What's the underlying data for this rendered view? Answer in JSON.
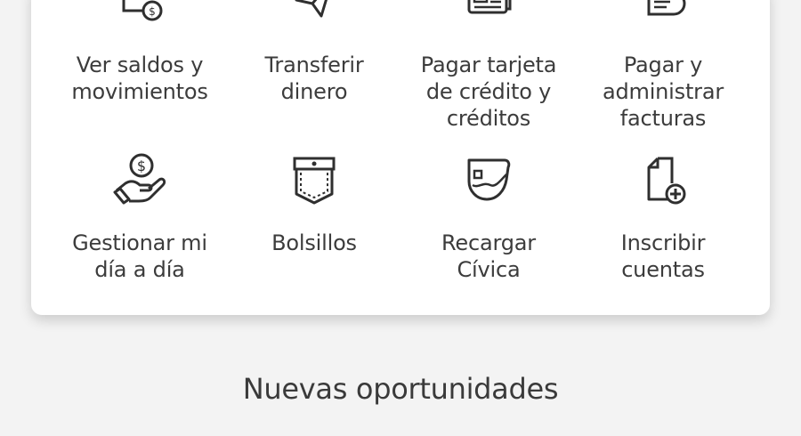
{
  "menu": {
    "items": [
      {
        "label": "Ver saldos y\nmovimientos",
        "icon": "document-money-icon"
      },
      {
        "label": "Transferir\ndinero",
        "icon": "paper-plane-icon"
      },
      {
        "label": "Pagar tarjeta\nde crédito y\ncréditos",
        "icon": "credit-card-icon"
      },
      {
        "label": "Pagar y\nadministrar\nfacturas",
        "icon": "invoice-icon"
      },
      {
        "label": "Gestionar mi\ndía a día",
        "icon": "hand-coin-icon"
      },
      {
        "label": "Bolsillos",
        "icon": "pocket-icon"
      },
      {
        "label": "Recargar\nCívica",
        "icon": "civica-card-icon"
      },
      {
        "label": "Inscribir\ncuentas",
        "icon": "add-document-icon"
      }
    ]
  },
  "sections": {
    "new_opportunities_title": "Nuevas oportunidades"
  },
  "colors": {
    "background": "#f3f3f3",
    "card": "#ffffff",
    "icon_stroke": "#2f2f2f",
    "text": "#3c3c3c"
  }
}
